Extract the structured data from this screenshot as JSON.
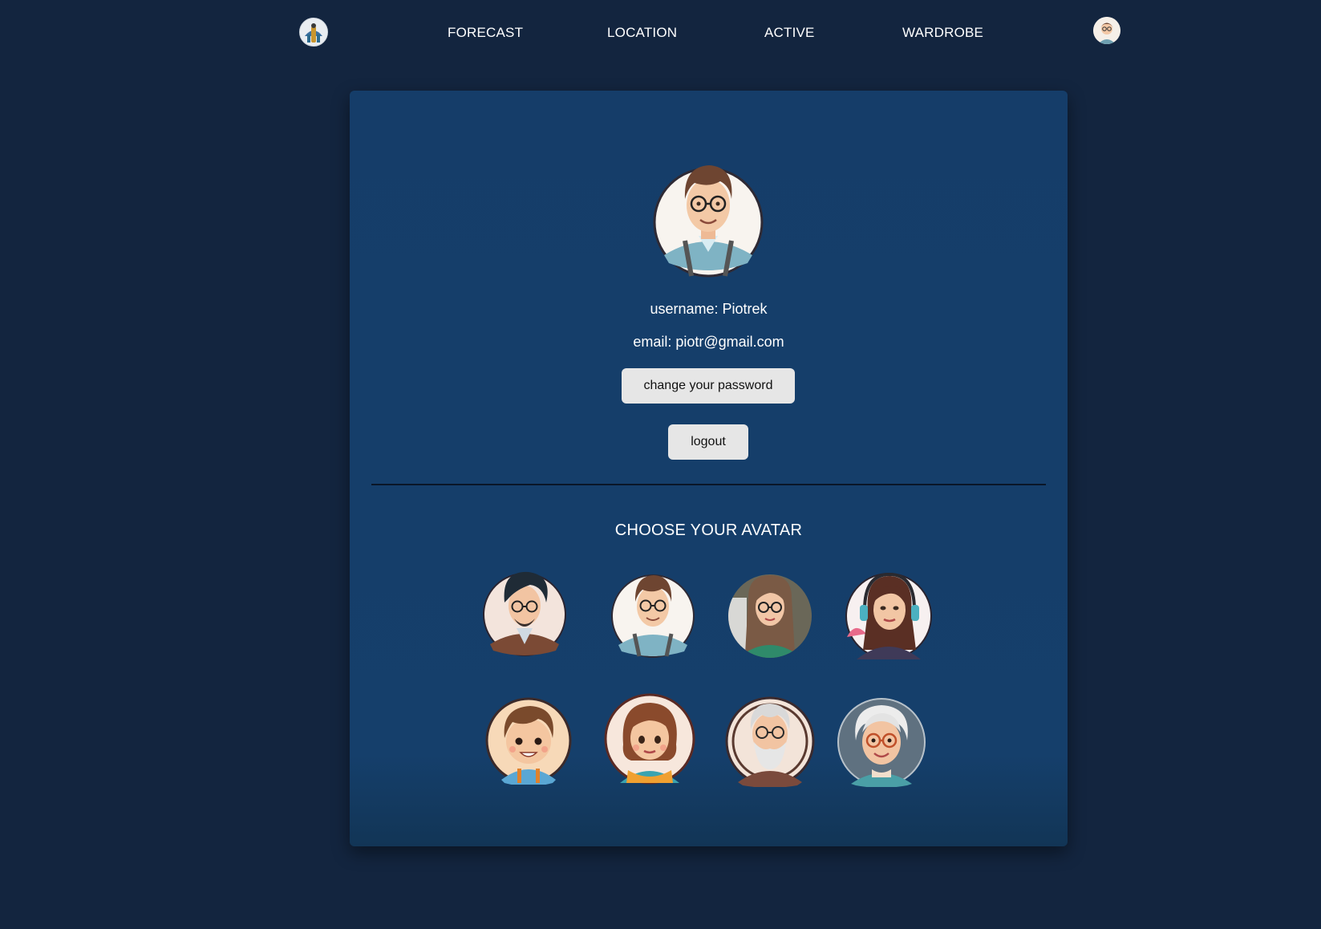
{
  "nav": {
    "logo_icon": "weather-logo-icon",
    "links": [
      "FORECAST",
      "LOCATION",
      "ACTIVE",
      "WARDROBE"
    ],
    "user_avatar_icon": "user-avatar-icon"
  },
  "profile": {
    "username": "username: Piotrek",
    "email": "email: piotr@gmail.com",
    "change_password_label": "change your password",
    "logout_label": "logout"
  },
  "avatars": {
    "title": "CHOOSE YOUR AVATAR",
    "options": [
      "man-dark-hair-glasses-avatar",
      "man-brown-hair-glasses-avatar",
      "woman-long-hair-glasses-avatar",
      "woman-headphones-avatar",
      "boy-avatar",
      "girl-avatar",
      "old-man-beard-glasses-avatar",
      "old-woman-glasses-avatar"
    ]
  },
  "colors": {
    "page_background": "#13253f",
    "card_background": "#153f6b",
    "button_background": "#e6e6e6",
    "divider": "#0a1628"
  }
}
